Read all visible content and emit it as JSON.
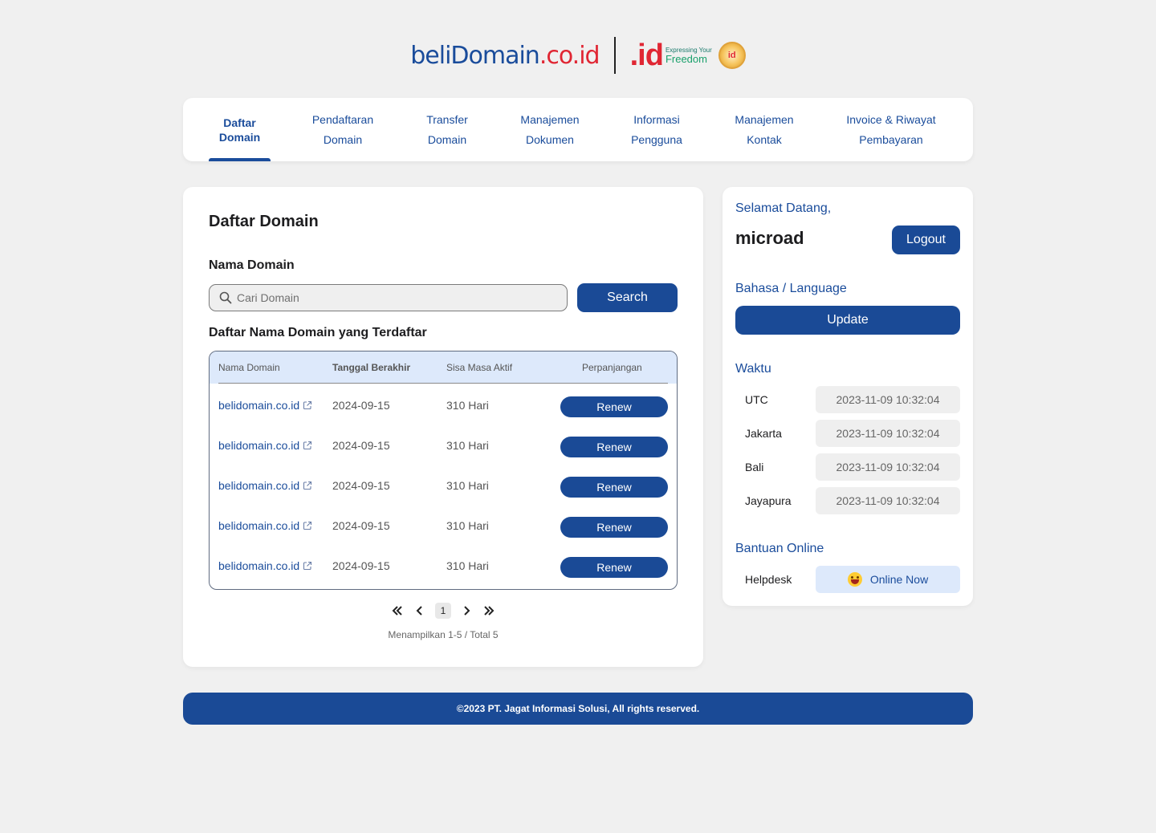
{
  "brand": {
    "beli_prefix": "beliDomain",
    "beli_tld": ".co.id",
    "id_mark": ".id",
    "id_tagline_small": "Expressing Your",
    "id_tagline": "Freedom",
    "seal_text": "id"
  },
  "nav": {
    "tabs": [
      {
        "line1": "Daftar",
        "line2": "Domain"
      },
      {
        "line1": "Pendaftaran",
        "line2": "Domain"
      },
      {
        "line1": "Transfer",
        "line2": "Domain"
      },
      {
        "line1": "Manajemen",
        "line2": "Dokumen"
      },
      {
        "line1": "Informasi",
        "line2": "Pengguna"
      },
      {
        "line1": "Manajemen",
        "line2": "Kontak"
      },
      {
        "line1": "Invoice & Riwayat",
        "line2": "Pembayaran"
      }
    ],
    "active_index": 0
  },
  "main": {
    "title": "Daftar Domain",
    "search_label": "Nama Domain",
    "search_placeholder": "Cari Domain",
    "search_value": "",
    "search_button": "Search",
    "list_title": "Daftar Nama Domain yang Terdaftar",
    "columns": [
      "Nama Domain",
      "Tanggal Berakhir",
      "Sisa Masa Aktif",
      "Perpanjangan"
    ],
    "rows": [
      {
        "domain": "belidomain.co.id",
        "expiry": "2024-09-15",
        "remaining": "310 Hari",
        "action": "Renew"
      },
      {
        "domain": "belidomain.co.id",
        "expiry": "2024-09-15",
        "remaining": "310 Hari",
        "action": "Renew"
      },
      {
        "domain": "belidomain.co.id",
        "expiry": "2024-09-15",
        "remaining": "310 Hari",
        "action": "Renew"
      },
      {
        "domain": "belidomain.co.id",
        "expiry": "2024-09-15",
        "remaining": "310 Hari",
        "action": "Renew"
      },
      {
        "domain": "belidomain.co.id",
        "expiry": "2024-09-15",
        "remaining": "310 Hari",
        "action": "Renew"
      }
    ],
    "pagination": {
      "current_page": "1",
      "info": "Menampilkan 1-5 / Total 5"
    }
  },
  "side": {
    "welcome": "Selamat Datang,",
    "username": "microad",
    "logout": "Logout",
    "language_title": "Bahasa / Language",
    "update": "Update",
    "time_title": "Waktu",
    "times": [
      {
        "city": "UTC",
        "value": "2023-11-09 10:32:04"
      },
      {
        "city": "Jakarta",
        "value": "2023-11-09 10:32:04"
      },
      {
        "city": "Bali",
        "value": "2023-11-09 10:32:04"
      },
      {
        "city": "Jayapura",
        "value": "2023-11-09 10:32:04"
      }
    ],
    "help_title": "Bantuan Online",
    "helpdesk_label": "Helpdesk",
    "helpdesk_status": "Online Now"
  },
  "footer": {
    "text": "©2023 PT. Jagat Informasi Solusi, All rights reserved."
  },
  "colors": {
    "primary": "#1a4a96",
    "link": "#1a4c9b",
    "accent_red": "#e02633",
    "header_row": "#dde9fb",
    "background": "#f0f0f0"
  }
}
